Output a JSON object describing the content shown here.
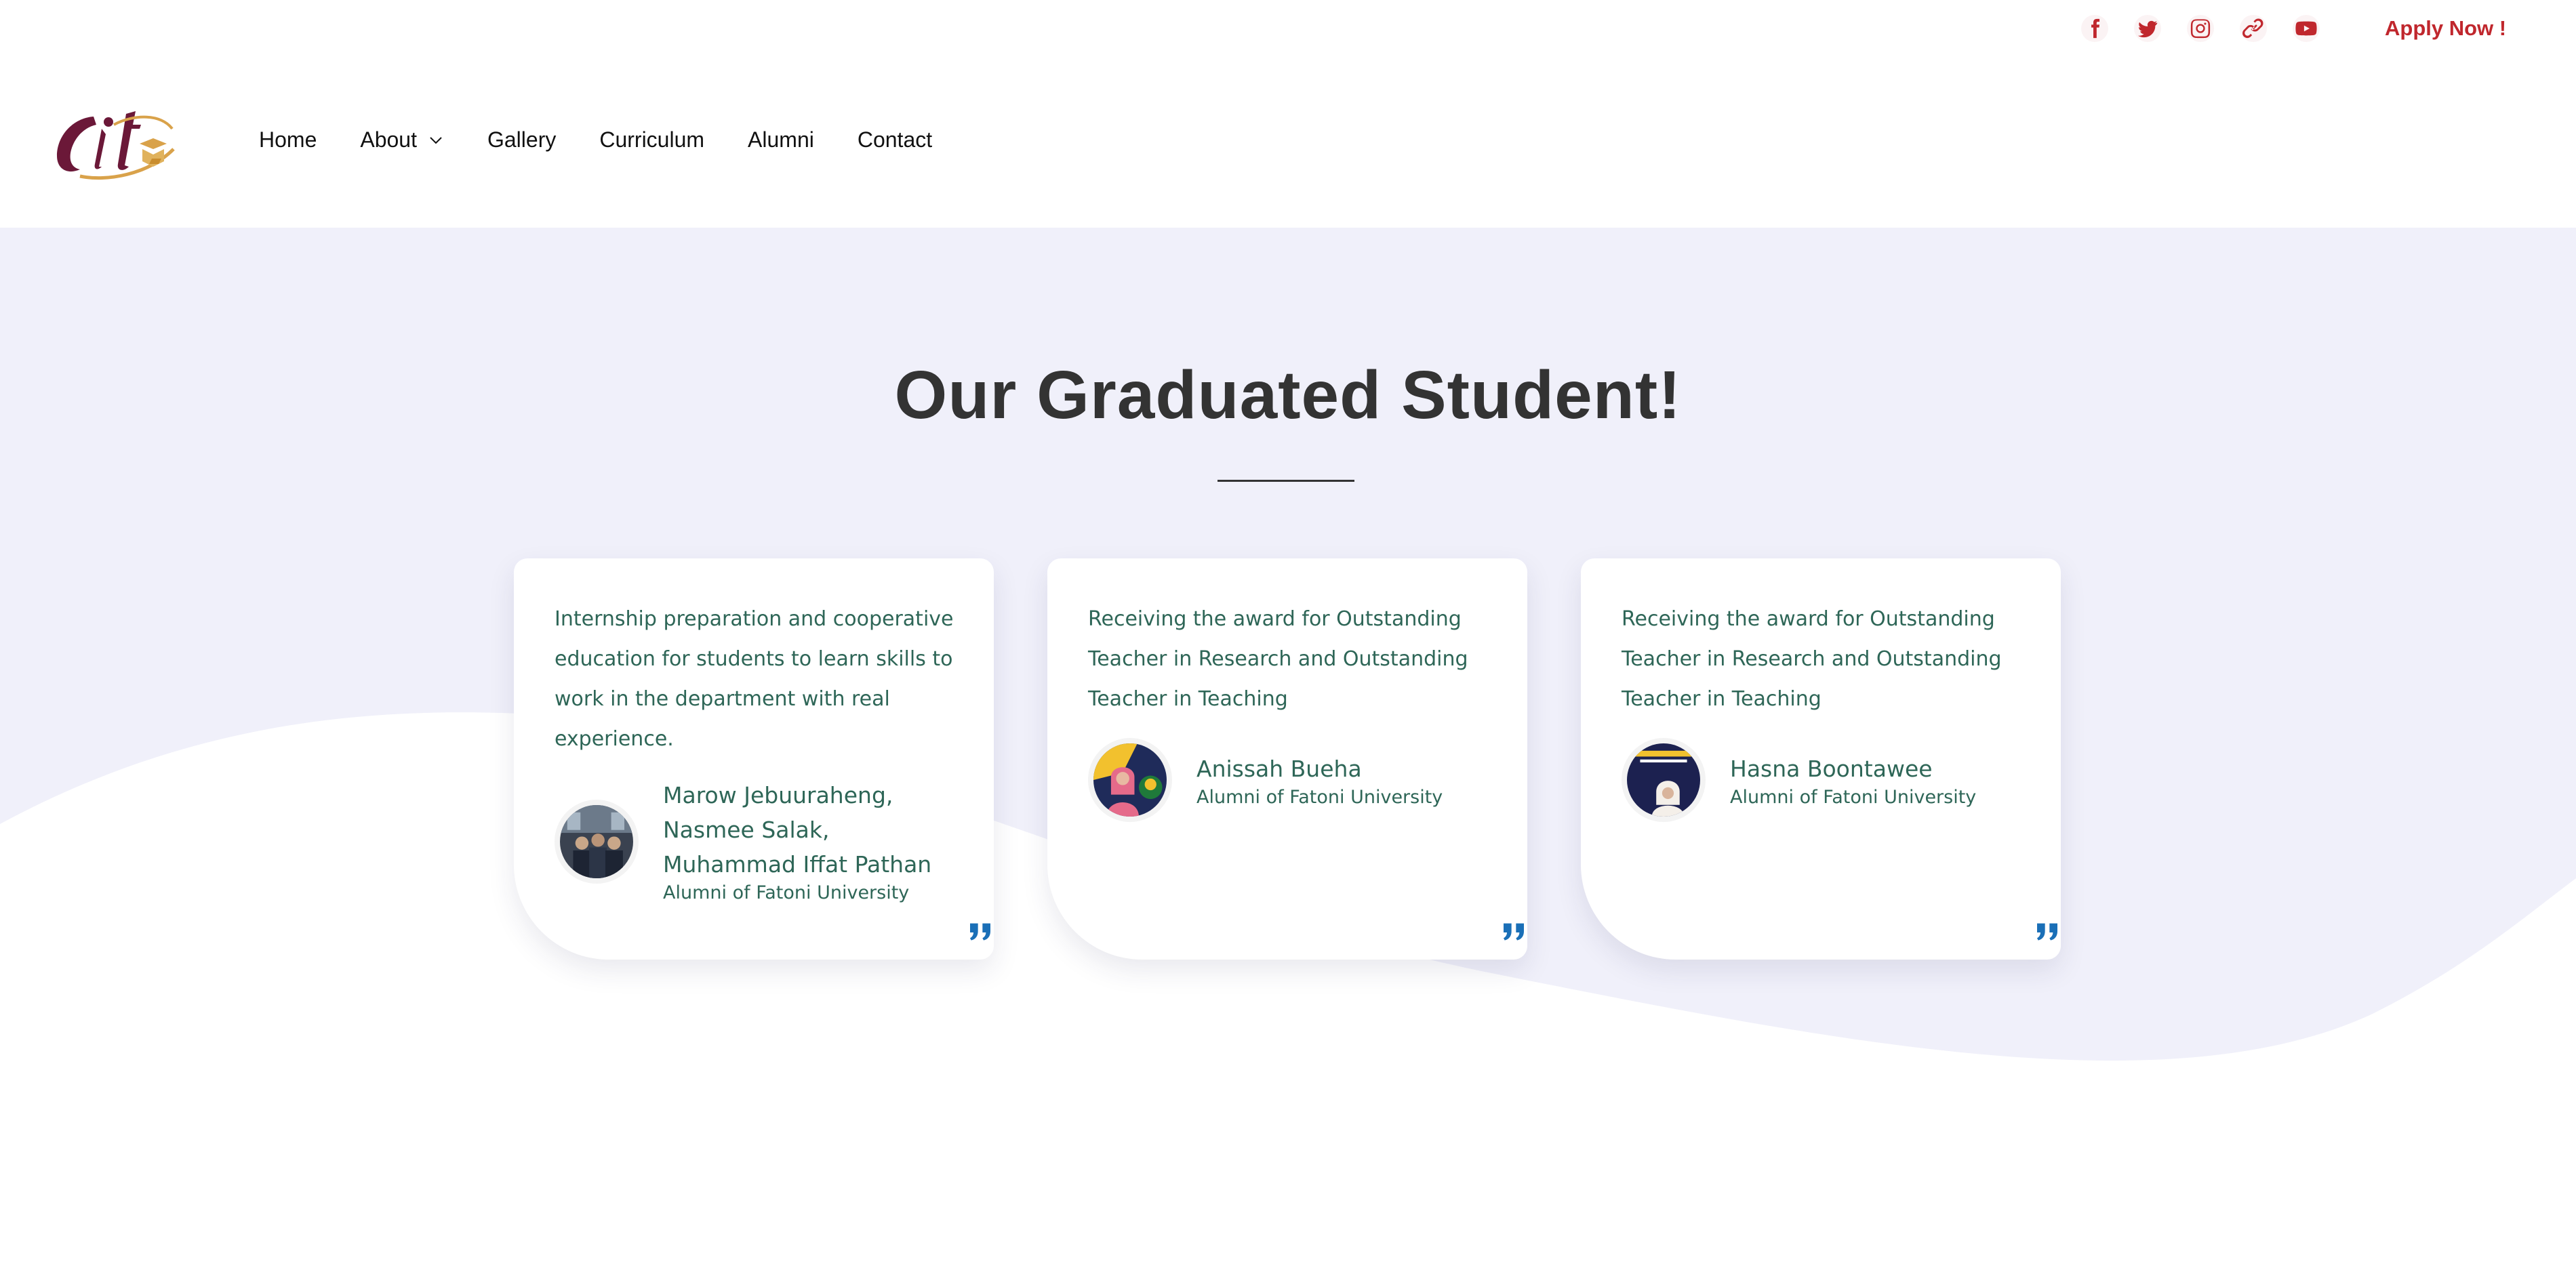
{
  "topbar": {
    "social_icons": [
      "facebook-icon",
      "twitter-icon",
      "instagram-icon",
      "link-icon",
      "youtube-icon"
    ],
    "apply_label": "Apply Now !",
    "accent_color": "#c0272d"
  },
  "header": {
    "logo_icon": "cit-logo",
    "nav": [
      {
        "label": "Home"
      },
      {
        "label": "About",
        "has_dropdown": true
      },
      {
        "label": "Gallery"
      },
      {
        "label": "Curriculum"
      },
      {
        "label": "Alumni"
      },
      {
        "label": "Contact"
      }
    ]
  },
  "main": {
    "title": "Our Graduated Student!",
    "background_color": "#f0f0fa",
    "testimonials": [
      {
        "text": "Internship preparation and cooperative education for students to learn skills to work in the department with real experience.",
        "name": "Marow Jebuuraheng, Nasmee Salak, Muhammad Iffat Pathan",
        "role": "Alumni of Fatoni University",
        "avatar_icon": "group-photo-avatar"
      },
      {
        "text": "Receiving the award for Outstanding Teacher in Research and Outstanding Teacher in Teaching",
        "name": "Anissah Bueha",
        "role": "Alumni of Fatoni University",
        "avatar_icon": "award-photo-avatar"
      },
      {
        "text": "Receiving the award for Outstanding Teacher in Research and Outstanding Teacher in Teaching",
        "name": "Hasna Boontawee",
        "role": "Alumni of Fatoni University",
        "avatar_icon": "award-photo-avatar"
      }
    ],
    "quote_color": "#1a6fb7"
  }
}
